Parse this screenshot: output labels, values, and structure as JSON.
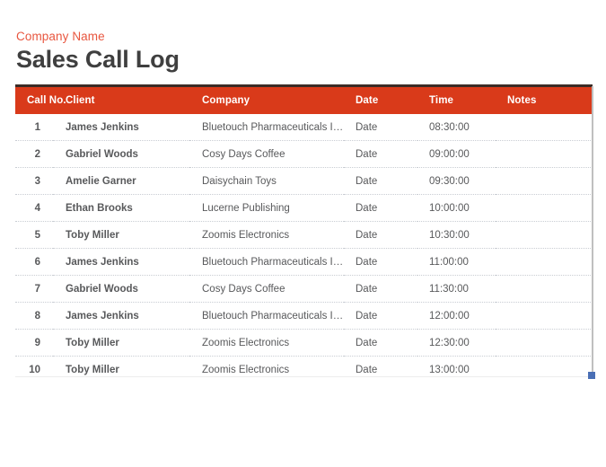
{
  "document": {
    "company_name": "Company Name",
    "title": "Sales Call Log"
  },
  "theme": {
    "header_bg": "#D93A1A",
    "header_top_border": "#3B2B26",
    "company_name_color": "#E8563F",
    "title_color": "#3F3F3F",
    "body_text_color": "#6D6E71",
    "row_separator_color": "#C9CDD3",
    "selection_handle_color": "#4A6FB5",
    "page_bg": "#FFFFFF"
  },
  "table": {
    "columns": [
      {
        "key": "call_no",
        "label": "Call No."
      },
      {
        "key": "client",
        "label": "Client"
      },
      {
        "key": "company",
        "label": "Company"
      },
      {
        "key": "date",
        "label": "Date"
      },
      {
        "key": "time",
        "label": "Time"
      },
      {
        "key": "notes",
        "label": "Notes"
      }
    ],
    "rows": [
      {
        "call_no": "1",
        "client": "James Jenkins",
        "company": "Bluetouch Pharmaceuticals Inc.",
        "date": "Date",
        "time": "08:30:00",
        "notes": ""
      },
      {
        "call_no": "2",
        "client": "Gabriel Woods",
        "company": "Cosy Days Coffee",
        "date": "Date",
        "time": "09:00:00",
        "notes": ""
      },
      {
        "call_no": "3",
        "client": "Amelie Garner",
        "company": "Daisychain Toys",
        "date": "Date",
        "time": "09:30:00",
        "notes": ""
      },
      {
        "call_no": "4",
        "client": "Ethan Brooks",
        "company": "Lucerne Publishing",
        "date": "Date",
        "time": "10:00:00",
        "notes": ""
      },
      {
        "call_no": "5",
        "client": "Toby Miller",
        "company": "Zoomis Electronics",
        "date": "Date",
        "time": "10:30:00",
        "notes": ""
      },
      {
        "call_no": "6",
        "client": "James Jenkins",
        "company": "Bluetouch Pharmaceuticals Inc.",
        "date": "Date",
        "time": "11:00:00",
        "notes": ""
      },
      {
        "call_no": "7",
        "client": "Gabriel Woods",
        "company": "Cosy Days Coffee",
        "date": "Date",
        "time": "11:30:00",
        "notes": ""
      },
      {
        "call_no": "8",
        "client": "James Jenkins",
        "company": "Bluetouch Pharmaceuticals Inc.",
        "date": "Date",
        "time": "12:00:00",
        "notes": ""
      },
      {
        "call_no": "9",
        "client": "Toby Miller",
        "company": "Zoomis Electronics",
        "date": "Date",
        "time": "12:30:00",
        "notes": ""
      },
      {
        "call_no": "10",
        "client": "Toby Miller",
        "company": "Zoomis Electronics",
        "date": "Date",
        "time": "13:00:00",
        "notes": ""
      }
    ]
  }
}
